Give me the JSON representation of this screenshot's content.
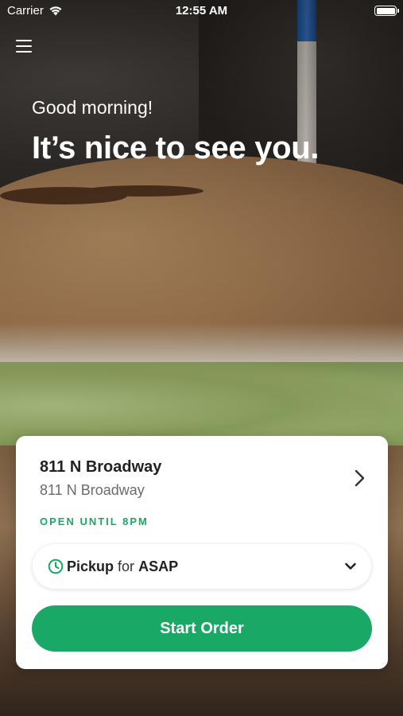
{
  "status_bar": {
    "carrier": "Carrier",
    "time": "12:55 AM"
  },
  "header": {
    "greeting": "Good morning!",
    "headline": "It’s nice to see you."
  },
  "location_card": {
    "location_name": "811 N Broadway",
    "address": "811 N Broadway",
    "hours": "OPEN UNTIL 8PM",
    "pickup": {
      "mode": "Pickup",
      "connector": "for",
      "time": "ASAP"
    },
    "start_order_label": "Start Order"
  },
  "colors": {
    "accent_green": "#1aa867",
    "card_background": "#ffffff",
    "primary_text": "#222222",
    "secondary_text": "#6b6b6b"
  },
  "icons": {
    "menu": "hamburger-icon",
    "wifi": "wifi-icon",
    "battery": "battery-icon",
    "location_chevron": "chevron-right-icon",
    "pickup_time": "clock-icon",
    "pickup_dropdown": "chevron-down-icon"
  }
}
